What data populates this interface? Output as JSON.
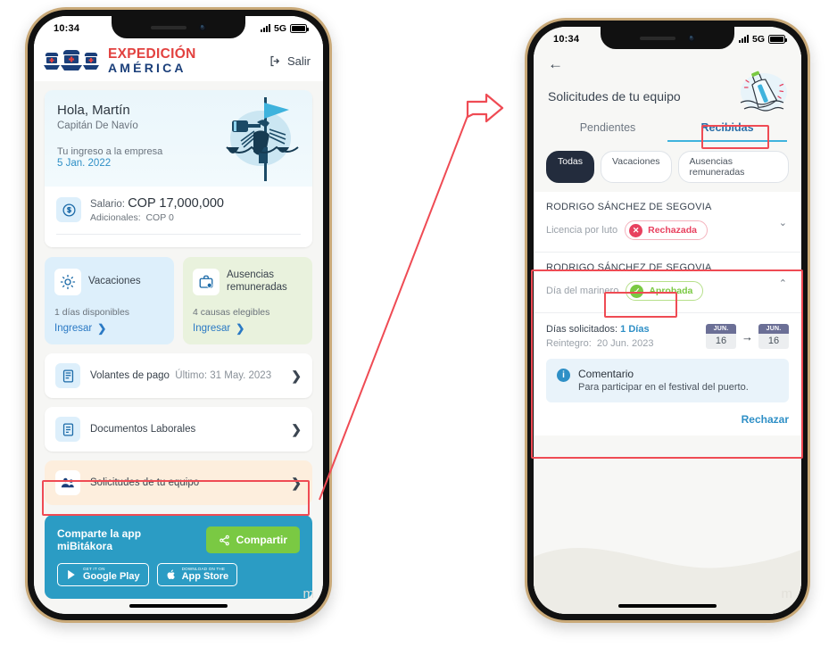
{
  "status_bar": {
    "time": "10:34",
    "network": "5G"
  },
  "left_phone": {
    "appbar": {
      "brand_line1": "EXPEDICIÓN",
      "brand_line2": "AMÉRICA",
      "logo_icon": "three-ships-logo",
      "logout_label": "Salir",
      "logout_icon": "logout-icon"
    },
    "hero": {
      "greeting": "Hola, Martín",
      "role": "Capitán De Navío",
      "entry_label": "Tu ingreso a la empresa",
      "entry_date": "5 Jan. 2022",
      "illustration": "sailor-lookout-illustration"
    },
    "salary": {
      "icon": "money-circle-icon",
      "label": "Salario:",
      "amount": "COP 17,000,000",
      "extra_label": "Adicionales:",
      "extra_amount": "COP 0"
    },
    "mini_cards": [
      {
        "icon": "sun-icon",
        "title": "Vacaciones",
        "subtitle": "1 días disponibles",
        "link": "Ingresar"
      },
      {
        "icon": "briefcase-clock-icon",
        "title": "Ausencias remuneradas",
        "subtitle": "4 causas elegibles",
        "link": "Ingresar"
      }
    ],
    "rows": [
      {
        "icon": "payslip-icon",
        "label": "Volantes de pago",
        "meta": "Último: 31 May. 2023"
      },
      {
        "icon": "document-icon",
        "label": "Documentos Laborales",
        "meta": ""
      },
      {
        "icon": "team-icon",
        "label": "Solicitudes de tu equipo",
        "meta": ""
      }
    ],
    "share": {
      "text": "Comparte la app miBitákora",
      "button": "Compartir",
      "button_icon": "share-icon",
      "stores": [
        {
          "icon": "google-play-icon",
          "small": "GET IT ON",
          "big": "Google Play"
        },
        {
          "icon": "apple-icon",
          "small": "Download on the",
          "big": "App Store"
        }
      ]
    },
    "watermark": "m"
  },
  "right_phone": {
    "back_icon": "back-arrow-icon",
    "title": "Solicitudes de tu equipo",
    "illustration": "message-in-bottle-illustration",
    "tabs": [
      {
        "label": "Pendientes",
        "active": false
      },
      {
        "label": "Recibidas",
        "active": true
      }
    ],
    "filters": [
      {
        "label": "Todas",
        "active": true
      },
      {
        "label": "Vacaciones",
        "active": false
      },
      {
        "label": "Ausencias remuneradas",
        "active": false
      }
    ],
    "requests": [
      {
        "name": "RODRIGO SÁNCHEZ DE SEGOVIA",
        "type": "Licencia por luto",
        "status": "Rechazada",
        "status_kind": "rejected",
        "status_icon": "x-circle-icon",
        "caret": "chevron-down-icon",
        "expanded": false
      },
      {
        "name": "RODRIGO SÁNCHEZ DE SEGOVIA",
        "type": "Día del marinero",
        "status": "Aprobada",
        "status_kind": "approved",
        "status_icon": "check-circle-icon",
        "caret": "chevron-up-icon",
        "expanded": true,
        "detail": {
          "days_label": "Días solicitados:",
          "days_value": "1 Días",
          "return_label": "Reintegro:",
          "return_value": "20 Jun. 2023",
          "date_from": {
            "month": "JUN.",
            "day": "16"
          },
          "date_to": {
            "month": "JUN.",
            "day": "16"
          },
          "arrow": "→",
          "comment_icon": "info-icon",
          "comment_title": "Comentario",
          "comment_text": "Para participar en el festival del puerto.",
          "action": "Rechazar"
        }
      }
    ],
    "watermark": "m"
  },
  "annotation": {
    "color": "#ef4b54",
    "arrow_icon": "block-arrow-right-icon",
    "boxes": [
      "solicitudes-de-tu-equipo-row",
      "recibidas-tab",
      "approved-request-card",
      "aprobada-badge"
    ]
  }
}
